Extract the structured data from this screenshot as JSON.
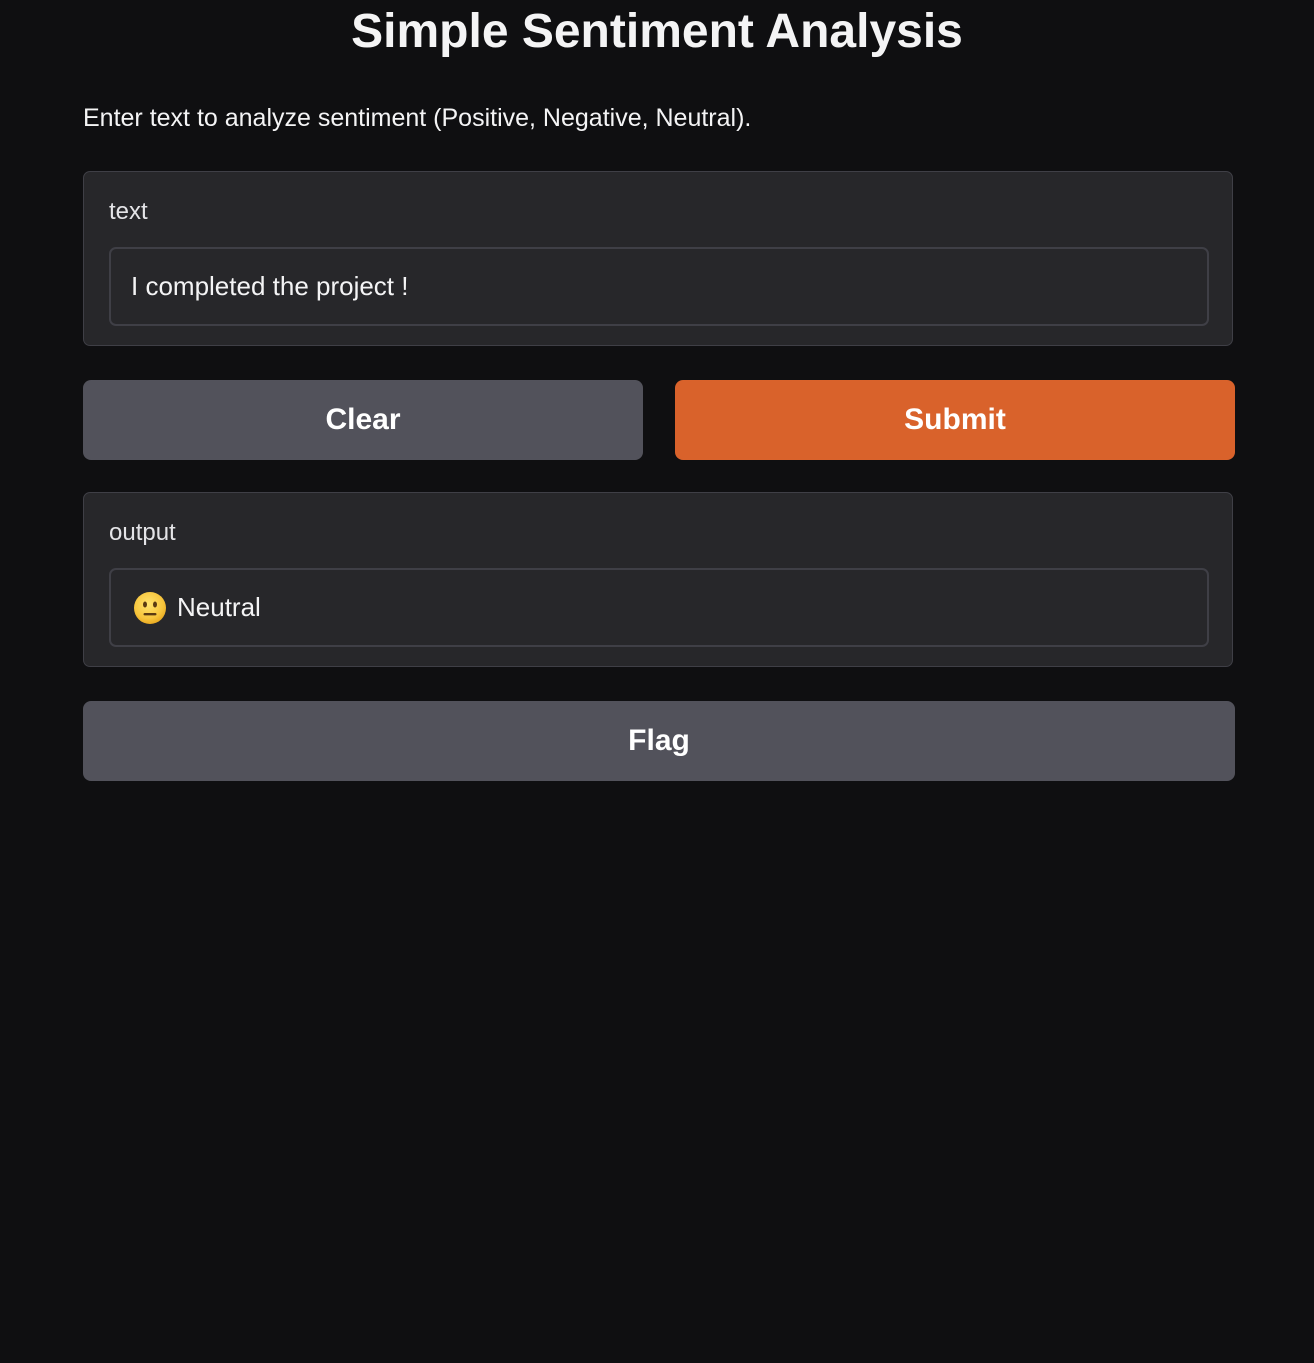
{
  "header": {
    "title": "Simple Sentiment Analysis",
    "description": "Enter text to analyze sentiment (Positive, Negative, Neutral)."
  },
  "input_block": {
    "label": "text",
    "value": "I completed the project !"
  },
  "actions": {
    "clear_label": "Clear",
    "submit_label": "Submit",
    "submit_color": "#d9622b",
    "secondary_color": "#52525b"
  },
  "output_block": {
    "label": "output",
    "icon": "neutral-face-emoji-icon",
    "value": "Neutral"
  },
  "flag": {
    "label": "Flag"
  },
  "theme": {
    "background": "#0f0f11",
    "panel": "#27272a",
    "border": "#3f3f46",
    "text": "#f4f4f5"
  }
}
